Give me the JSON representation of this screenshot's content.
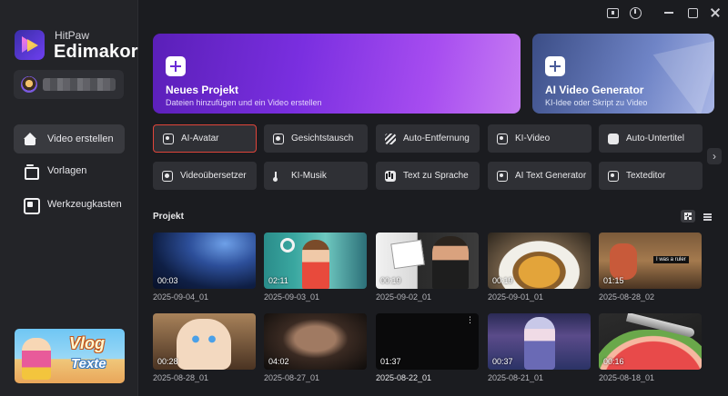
{
  "app": {
    "brand_small": "HitPaw",
    "brand_big": "Edimakor"
  },
  "sidebar": {
    "items": [
      {
        "label": "Video erstellen",
        "icon": "home-icon",
        "active": true
      },
      {
        "label": "Vorlagen",
        "icon": "template-icon",
        "active": false
      },
      {
        "label": "Werkzeugkasten",
        "icon": "toolbox-icon",
        "active": false
      }
    ],
    "promo": {
      "line1": "Vlog",
      "line2": "Texte"
    }
  },
  "window_controls": [
    "feedback-icon",
    "info-icon",
    "minimize-icon",
    "maximize-icon",
    "close-icon"
  ],
  "hero": {
    "new_project": {
      "title": "Neues Projekt",
      "subtitle": "Dateien hinzufügen und ein Video erstellen"
    },
    "ai_video": {
      "title": "AI Video Generator",
      "subtitle": "KI-Idee oder Skript zu Video"
    }
  },
  "tools": [
    {
      "label": "AI-Avatar",
      "icon": "avatar-icon",
      "selected": true
    },
    {
      "label": "Gesichtstausch",
      "icon": "face-swap-icon",
      "selected": false
    },
    {
      "label": "Auto-Entfernung",
      "icon": "auto-remove-icon",
      "selected": false
    },
    {
      "label": "KI-Video",
      "icon": "ai-video-icon",
      "selected": false
    },
    {
      "label": "Auto-Untertitel",
      "icon": "subtitle-icon",
      "selected": false
    },
    {
      "label": "Videoübersetzer",
      "icon": "translate-icon",
      "selected": false
    },
    {
      "label": "KI-Musik",
      "icon": "music-icon",
      "selected": false
    },
    {
      "label": "Text zu Sprache",
      "icon": "tts-icon",
      "selected": false
    },
    {
      "label": "AI Text Generator",
      "icon": "text-gen-icon",
      "selected": false
    },
    {
      "label": "Texteditor",
      "icon": "text-editor-icon",
      "selected": false
    }
  ],
  "projects": {
    "title": "Projekt",
    "items": [
      {
        "name": "2025-09-04_01",
        "duration": "00:03"
      },
      {
        "name": "2025-09-03_01",
        "duration": "02:11"
      },
      {
        "name": "2025-09-02_01",
        "duration": "00:19"
      },
      {
        "name": "2025-09-01_01",
        "duration": "00:19"
      },
      {
        "name": "2025-08-28_02",
        "duration": "01:15",
        "overlay": "I was a ruler"
      },
      {
        "name": "2025-08-28_01",
        "duration": "00:28"
      },
      {
        "name": "2025-08-27_01",
        "duration": "04:02"
      },
      {
        "name": "2025-08-22_01",
        "duration": "01:37"
      },
      {
        "name": "2025-08-21_01",
        "duration": "00:37"
      },
      {
        "name": "2025-08-18_01",
        "duration": "00:16"
      }
    ]
  },
  "colors": {
    "accent_selected": "#e0453a",
    "hero_new": "#7a2fe0",
    "hero_ai": "#6f84c6",
    "background": "#1b1c20"
  }
}
